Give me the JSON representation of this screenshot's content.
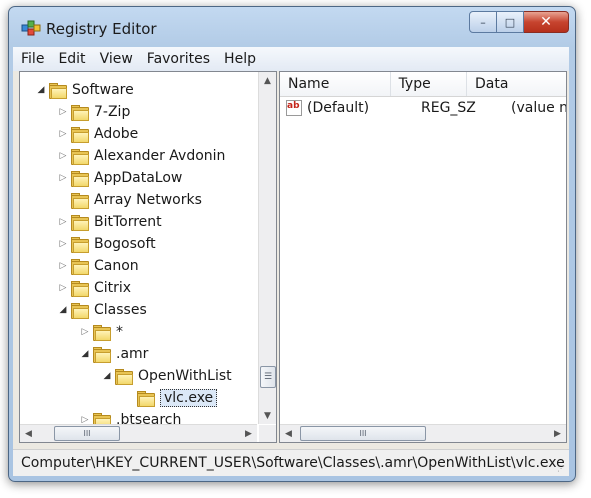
{
  "window": {
    "title": "Registry Editor"
  },
  "caption": {
    "minimize": "–",
    "maximize": "□",
    "close": "✕"
  },
  "menu": [
    "File",
    "Edit",
    "View",
    "Favorites",
    "Help"
  ],
  "tree": [
    {
      "label": "Software",
      "level": 0,
      "expander": "expanded"
    },
    {
      "label": "7-Zip",
      "level": 1,
      "expander": "collapsed"
    },
    {
      "label": "Adobe",
      "level": 1,
      "expander": "collapsed"
    },
    {
      "label": "Alexander Avdonin",
      "level": 1,
      "expander": "collapsed"
    },
    {
      "label": "AppDataLow",
      "level": 1,
      "expander": "collapsed"
    },
    {
      "label": "Array Networks",
      "level": 1,
      "expander": "none"
    },
    {
      "label": "BitTorrent",
      "level": 1,
      "expander": "collapsed"
    },
    {
      "label": "Bogosoft",
      "level": 1,
      "expander": "collapsed"
    },
    {
      "label": "Canon",
      "level": 1,
      "expander": "collapsed"
    },
    {
      "label": "Citrix",
      "level": 1,
      "expander": "collapsed"
    },
    {
      "label": "Classes",
      "level": 1,
      "expander": "expanded"
    },
    {
      "label": "*",
      "level": 2,
      "expander": "collapsed"
    },
    {
      "label": ".amr",
      "level": 2,
      "expander": "expanded"
    },
    {
      "label": "OpenWithList",
      "level": 3,
      "expander": "expanded"
    },
    {
      "label": "vlc.exe",
      "level": 4,
      "expander": "none",
      "selected": true
    },
    {
      "label": ".btsearch",
      "level": 2,
      "expander": "collapsed"
    }
  ],
  "list": {
    "columns": [
      "Name",
      "Type",
      "Data"
    ],
    "rows": [
      {
        "name": "(Default)",
        "type": "REG_SZ",
        "data": "(value no",
        "icon": "ab-string-icon"
      }
    ]
  },
  "scroll": {
    "hthumb": "III",
    "vthumb": "☰"
  },
  "status": {
    "path": "Computer\\HKEY_CURRENT_USER\\Software\\Classes\\.amr\\OpenWithList\\vlc.exe"
  }
}
